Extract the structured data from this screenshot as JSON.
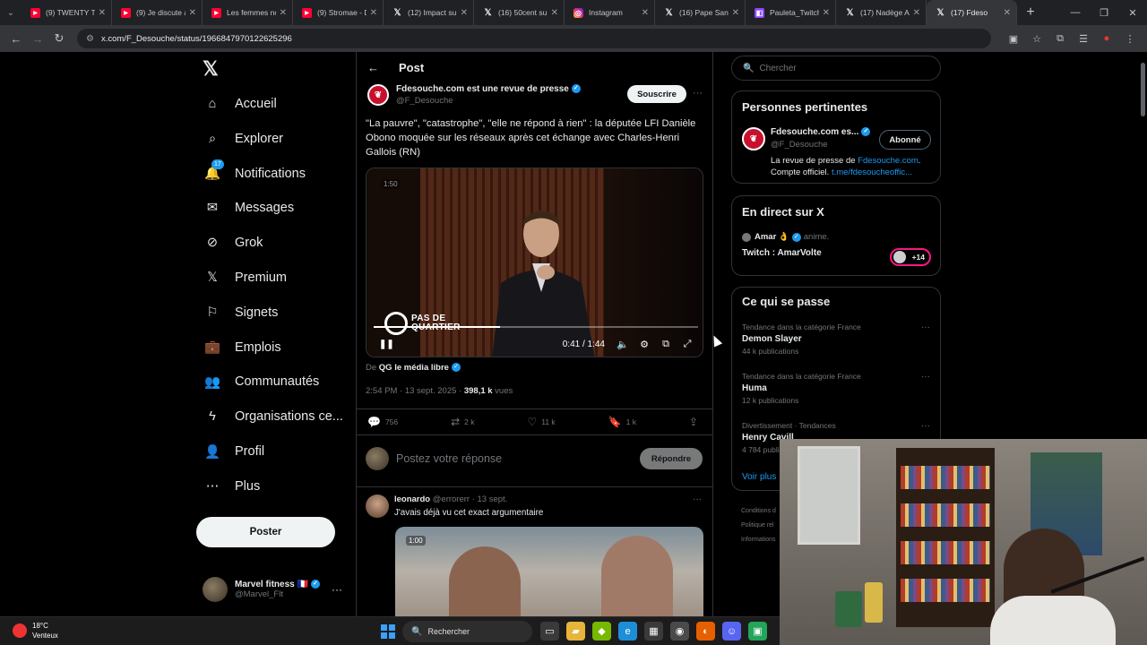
{
  "browser": {
    "tabs": [
      {
        "title": "(9) TWENTY TW",
        "type": "yt"
      },
      {
        "title": "(9) Je discute a",
        "type": "yt"
      },
      {
        "title": "Les femmes no",
        "type": "yt"
      },
      {
        "title": "(9) Stromae - D",
        "type": "yt"
      },
      {
        "title": "(12) Impact su",
        "type": "x"
      },
      {
        "title": "(16) 50cent su",
        "type": "x"
      },
      {
        "title": "Instagram",
        "type": "ig"
      },
      {
        "title": "(16) Pape San",
        "type": "x"
      },
      {
        "title": "Pauleta_Twitch",
        "type": "tw"
      },
      {
        "title": "(17) Nadège A",
        "type": "x"
      },
      {
        "title": "(17) Fdeso",
        "type": "x",
        "active": true
      }
    ],
    "url": "x.com/F_Desouche/status/1966847970122625296"
  },
  "nav": {
    "items": [
      {
        "label": "Accueil",
        "icon": "home-icon"
      },
      {
        "label": "Explorer",
        "icon": "search-icon"
      },
      {
        "label": "Notifications",
        "icon": "bell-icon",
        "badge": "17"
      },
      {
        "label": "Messages",
        "icon": "mail-icon"
      },
      {
        "label": "Grok",
        "icon": "grok-icon"
      },
      {
        "label": "Premium",
        "icon": "x-icon"
      },
      {
        "label": "Signets",
        "icon": "bookmark-icon"
      },
      {
        "label": "Emplois",
        "icon": "briefcase-icon"
      },
      {
        "label": "Communautés",
        "icon": "people-icon"
      },
      {
        "label": "Organisations ce...",
        "icon": "lightning-icon"
      },
      {
        "label": "Profil",
        "icon": "person-icon"
      },
      {
        "label": "Plus",
        "icon": "more-circle-icon"
      }
    ],
    "post_button": "Poster",
    "account": {
      "name": "Marvel fitness 🇫🇷",
      "handle": "@Marvel_Flt"
    }
  },
  "post": {
    "header": "Post",
    "author": {
      "name": "Fdesouche.com est une revue de presse",
      "handle": "@F_Desouche"
    },
    "subscribe_label": "Souscrire",
    "text": "\"La pauvre\", \"catastrophe\", \"elle ne répond à rien\" : la députée LFI Danièle Obono moquée sur les réseaux après cet échange avec Charles-Henri Gallois (RN)",
    "video": {
      "timer_badge": "1:50",
      "logo_line1": "PAS DE",
      "logo_line2": "QUARTIER",
      "time": "0:41 / 1:44",
      "progress": 0.39
    },
    "from_prefix": "De",
    "from_source": "QG le média libre",
    "timestamp": "2:54 PM · 13 sept. 2025 · ",
    "views_count": "398,1 k",
    "views_label": " vues",
    "stats": {
      "replies": "756",
      "reposts": "2 k",
      "likes": "11 k",
      "bookmarks": "1 k"
    },
    "reply_placeholder": "Postez votre réponse",
    "reply_button": "Répondre"
  },
  "reply": {
    "name": "leonardo",
    "handle": "@errorerr",
    "date": " · 13 sept.",
    "text": "J'avais déjà vu cet exact argumentaire",
    "media_timer": "1:00"
  },
  "sidebar": {
    "search_placeholder": "Chercher",
    "relevant": {
      "title": "Personnes pertinentes",
      "name": "Fdesouche.com es...",
      "handle": "@F_Desouche",
      "follow_label": "Abonné",
      "bio_prefix": "La revue de presse de ",
      "bio_link1": "Fdesouche.com",
      "bio_mid": ". Compte officiel. ",
      "bio_link2": "t.me/fdesoucheoffic..."
    },
    "live": {
      "title": "En direct sur X",
      "user": "Amar 👌",
      "status": "anime.",
      "stream_title": "Twitch : AmarVolte",
      "listeners": "+14"
    },
    "trending": {
      "title": "Ce qui se passe",
      "items": [
        {
          "category": "Tendance dans la catégorie France",
          "name": "Demon Slayer",
          "posts": "44 k publications"
        },
        {
          "category": "Tendance dans la catégorie France",
          "name": "Huma",
          "posts": "12 k publications"
        },
        {
          "category": "Divertissement · Tendances",
          "name": "Henry Cavill",
          "posts": "4 784 publications"
        }
      ],
      "see_more": "Voir plus"
    },
    "footer": [
      "Conditions d",
      "Politique rel",
      "Informations"
    ]
  },
  "taskbar": {
    "temperature": "18°C",
    "weather": "Venteux",
    "search_label": "Rechercher"
  },
  "colors": {
    "accent": "#1d9bf0",
    "live": "#f91880",
    "brand_red": "#c8102e"
  }
}
